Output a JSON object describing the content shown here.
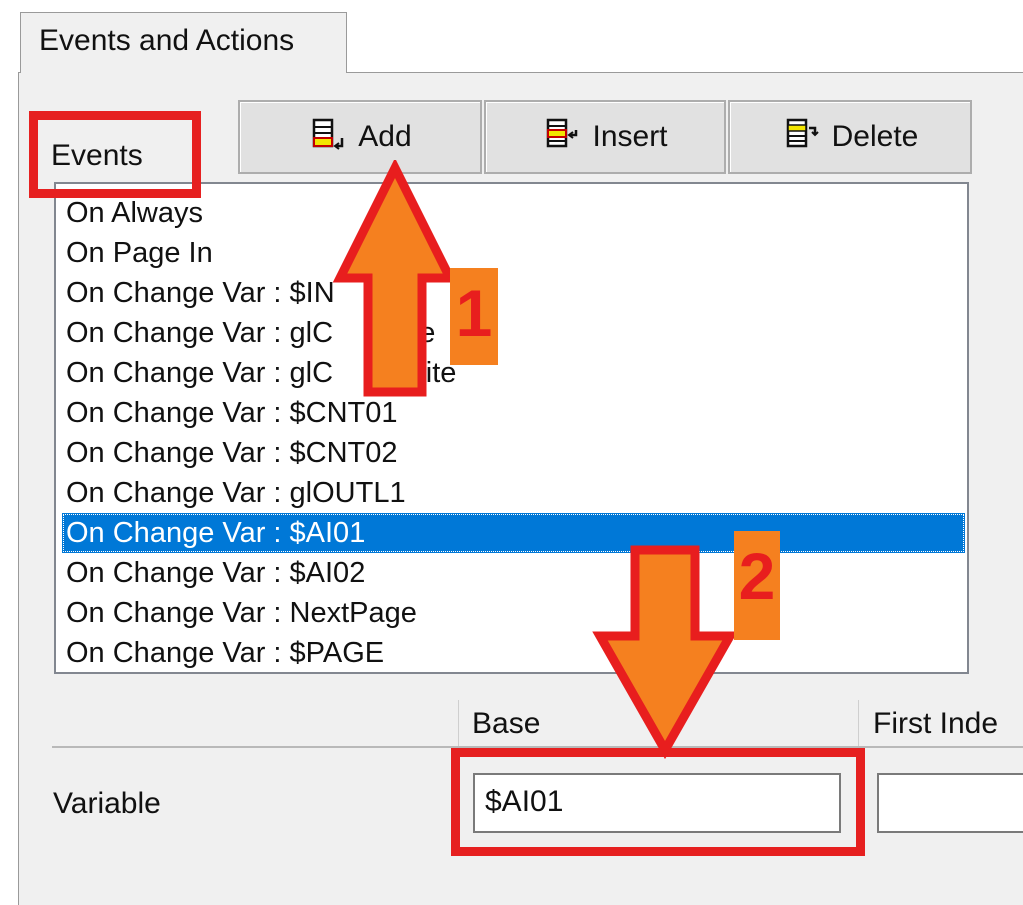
{
  "tab": {
    "label": "Events and Actions"
  },
  "events": {
    "label": "Events",
    "buttons": {
      "add": "Add",
      "insert": "Insert",
      "delete": "Delete"
    },
    "items": [
      "On Always",
      "On Page In",
      "On Change Var : $IN",
      "On Change Var : glC",
      "On Change Var : glC",
      "On Change Var : $CNT01",
      "On Change Var : $CNT02",
      "On Change Var : glOUTL1",
      "On Change Var : $AI01",
      "On Change Var : $AI02",
      "On Change Var : NextPage",
      "On Change Var : $PAGE"
    ],
    "partial_suffixes": {
      "item3": "1",
      "item3_b": "e",
      "item4": "2write"
    },
    "selected_index": 8
  },
  "variable_table": {
    "headers": {
      "base": "Base",
      "first_index": "First Inde"
    },
    "row_label": "Variable",
    "base_value": "$AI01",
    "first_index_value": ""
  },
  "annotations": {
    "step1": "1",
    "step2": "2",
    "colors": {
      "highlight": "#e62020",
      "arrow_fill": "#f5801f",
      "arrow_stroke": "#e81e1e",
      "selection": "#0078d7"
    }
  }
}
